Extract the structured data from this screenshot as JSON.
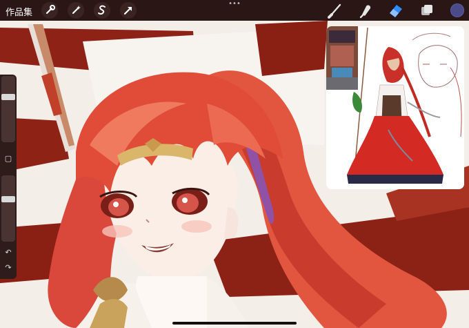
{
  "topbar": {
    "gallery_label": "作品集",
    "left_tools": [
      "wrench-icon",
      "magic-wand-icon",
      "selection-icon",
      "transform-arrow-icon"
    ],
    "right_tools": [
      "brush-icon",
      "smudge-icon",
      "eraser-icon",
      "layers-icon"
    ],
    "more_dots": "•••",
    "active_tool": "eraser",
    "colors": {
      "bar_background": "#2a1614",
      "active_tool": "#2f8cff",
      "current_color": "#4b4b8a"
    }
  },
  "sidebar": {
    "brush_size_level": 0.7,
    "opacity_level": 0.65,
    "modify_button": "▢",
    "undo_glyph": "↶",
    "redo_glyph": "↷"
  },
  "reference": {
    "visible": true
  }
}
